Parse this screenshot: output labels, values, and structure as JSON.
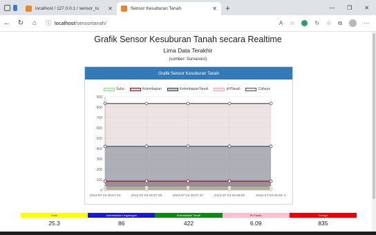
{
  "browser": {
    "tabs": [
      {
        "label": "localhost / 127.0.0.1 / sensor_tu",
        "favicon_color": "#e8862c",
        "active": false
      },
      {
        "label": "Sensor Kesuburan Tanah",
        "favicon_color": "#e8862c",
        "active": true
      }
    ],
    "url_host": "localhost",
    "url_path": "/sensortanah/",
    "window_controls": [
      "minimize-icon",
      "maximize-icon",
      "close-icon"
    ]
  },
  "page": {
    "title": "Grafik Sensor Kesuburan Tanah secara Realtime",
    "subtitle": "Lima Data Terakhir",
    "source": "(sumber: Sumanoro)",
    "panel_heading": "Grafik Sensor Kesuburan Tanah"
  },
  "chart_data": {
    "type": "line",
    "x": [
      "2022-07-03 05:57:24",
      "2022-07-03 05:57:35",
      "2022-07-03 05:57:47",
      "2022-07-03 05:58:00",
      "2022-07-03 05:58: 2"
    ],
    "ylim": [
      0,
      900
    ],
    "yticks": [
      0,
      100,
      200,
      300,
      400,
      500,
      600,
      700,
      800,
      900
    ],
    "grid": true,
    "legend_position": "top",
    "series": [
      {
        "name": "Suhu",
        "values": [
          25,
          25,
          25,
          25,
          25
        ],
        "color": "#8fe58f",
        "fill": "rgba(150,230,150,0.35)"
      },
      {
        "name": "Kelembapan",
        "values": [
          86,
          86,
          86,
          86,
          86
        ],
        "color": "#7a1f2b",
        "fill": "rgba(120,30,40,0.25)"
      },
      {
        "name": "KelembapanTanah",
        "values": [
          422,
          422,
          422,
          422,
          422
        ],
        "color": "#2f4d63",
        "fill": "rgba(60,80,100,0.35)"
      },
      {
        "name": "pHTanah",
        "values": [
          6,
          6,
          6,
          6,
          6
        ],
        "color": "#f2a7b5",
        "fill": "rgba(242,167,181,0.35)"
      },
      {
        "name": "Cahaya",
        "values": [
          835,
          835,
          835,
          835,
          835
        ],
        "color": "#555555",
        "fill": "rgba(215,190,195,0.45)"
      }
    ]
  },
  "stats": [
    {
      "label": "Suhu",
      "value": "25.3",
      "color": "#ffff00"
    },
    {
      "label": "Kelembaban Lingkungan",
      "value": "86",
      "color": "#1a1acd"
    },
    {
      "label": "Kelembaban Tanah",
      "value": "422",
      "color": "#0c8a14"
    },
    {
      "label": "Ph Tanah",
      "value": "6.09",
      "color": "#ffc0cb"
    },
    {
      "label": "Cahaya",
      "value": "835",
      "color": "#ee0000"
    }
  ]
}
